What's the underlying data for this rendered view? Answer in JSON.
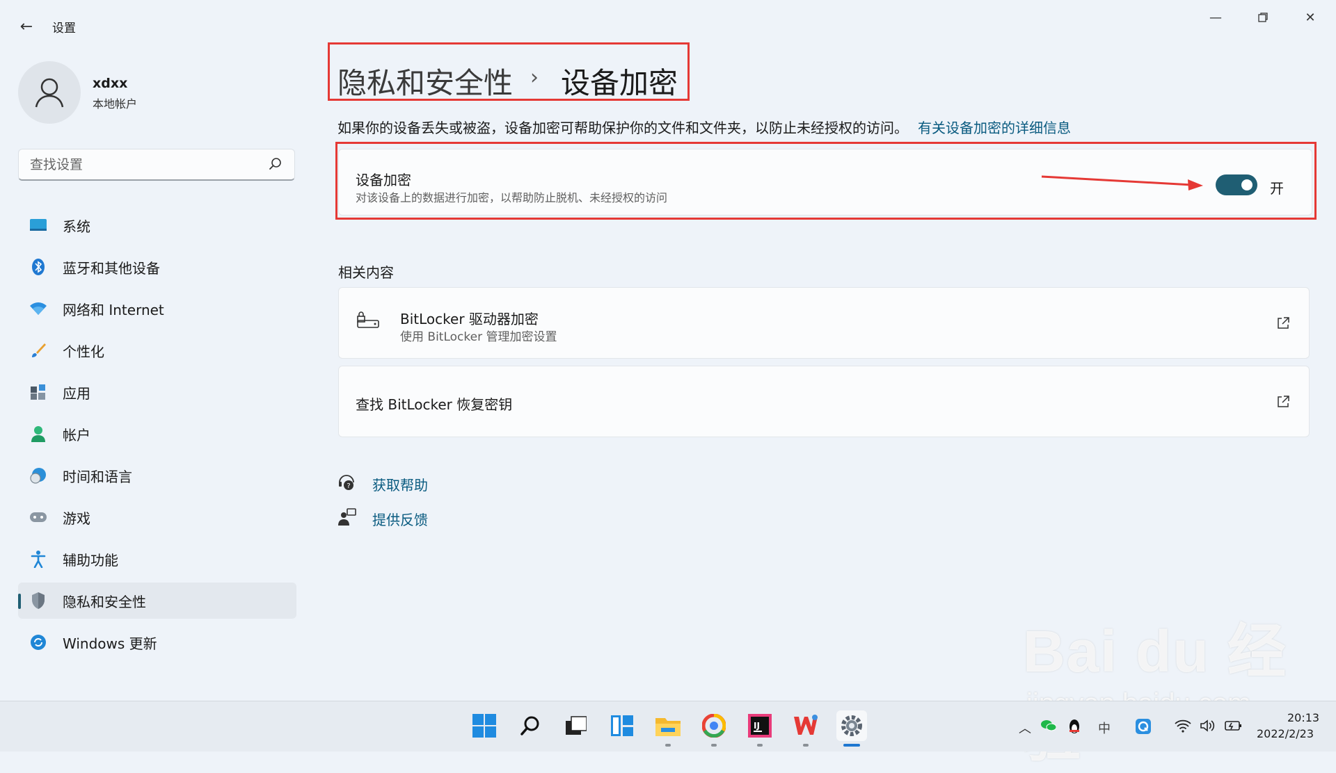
{
  "app": {
    "title": "设置"
  },
  "profile": {
    "name": "xdxx",
    "account_type": "本地帐户"
  },
  "search": {
    "placeholder": "查找设置"
  },
  "nav": {
    "items": [
      {
        "label": "系统",
        "icon": "monitor-icon"
      },
      {
        "label": "蓝牙和其他设备",
        "icon": "bluetooth-icon"
      },
      {
        "label": "网络和 Internet",
        "icon": "wifi-icon"
      },
      {
        "label": "个性化",
        "icon": "brush-icon"
      },
      {
        "label": "应用",
        "icon": "apps-icon"
      },
      {
        "label": "帐户",
        "icon": "person-icon"
      },
      {
        "label": "时间和语言",
        "icon": "globe-clock-icon"
      },
      {
        "label": "游戏",
        "icon": "gamepad-icon"
      },
      {
        "label": "辅助功能",
        "icon": "accessibility-icon"
      },
      {
        "label": "隐私和安全性",
        "icon": "shield-icon",
        "active": true
      },
      {
        "label": "Windows 更新",
        "icon": "update-icon"
      }
    ]
  },
  "breadcrumb": {
    "parent": "隐私和安全性",
    "separator": "›",
    "current": "设备加密"
  },
  "description": {
    "text": "如果你的设备丢失或被盗，设备加密可帮助保护你的文件和文件夹，以防止未经授权的访问。",
    "link": "有关设备加密的详细信息"
  },
  "encryption": {
    "title": "设备加密",
    "subtitle": "对该设备上的数据进行加密，以帮助防止脱机、未经授权的访问",
    "toggle_on": true,
    "toggle_state_label": "开"
  },
  "related": {
    "heading": "相关内容",
    "items": [
      {
        "title": "BitLocker 驱动器加密",
        "subtitle": "使用 BitLocker 管理加密设置"
      },
      {
        "title": "查找 BitLocker 恢复密钥"
      }
    ]
  },
  "links": {
    "help": "获取帮助",
    "feedback": "提供反馈"
  },
  "tray": {
    "ime": "中",
    "time": "20:13",
    "date": "2022/2/23"
  },
  "watermark": {
    "brand": "Bai du 经验",
    "url": "jingyan.baidu.com"
  },
  "colors": {
    "accent": "#1f5e73",
    "link": "#0a5b80",
    "highlight": "#e53935"
  }
}
